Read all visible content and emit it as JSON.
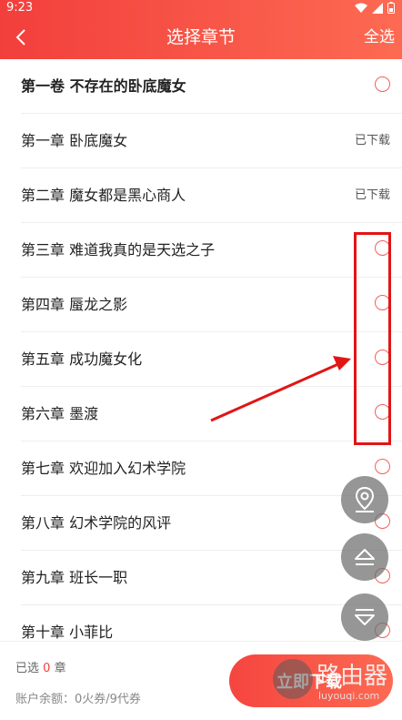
{
  "status_bar": {
    "time": "9:23"
  },
  "app_bar": {
    "title": "选择章节",
    "select_all": "全选"
  },
  "chapters": [
    {
      "title": "第一卷 不存在的卧底魔女",
      "state": "",
      "is_volume": true
    },
    {
      "title": "第一章 卧底魔女",
      "state": "已下载"
    },
    {
      "title": "第二章 魔女都是黑心商人",
      "state": "已下载"
    },
    {
      "title": "第三章 难道我真的是天选之子",
      "state": ""
    },
    {
      "title": "第四章 蜃龙之影",
      "state": ""
    },
    {
      "title": "第五章 成功魔女化",
      "state": ""
    },
    {
      "title": "第六章 墨渡",
      "state": ""
    },
    {
      "title": "第七章 欢迎加入幻术学院",
      "state": ""
    },
    {
      "title": "第八章 幻术学院的风评",
      "state": ""
    },
    {
      "title": "第九章 班长一职",
      "state": ""
    },
    {
      "title": "第十章 小菲比",
      "state": ""
    }
  ],
  "bottom": {
    "selected_prefix": "已选",
    "selected_count": "0",
    "selected_suffix": "章",
    "balance": "账户余额：0火券/9代券",
    "download_label": "立即下载"
  },
  "watermark": {
    "cn": "路由器",
    "en": "luyouqi.com"
  },
  "colors": {
    "accent": "#f23f3c",
    "accent_end": "#fd6a52",
    "annotation": "#e11515"
  },
  "icons": [
    "back-arrow-icon",
    "wifi-icon",
    "signal-icon",
    "battery-icon",
    "location-pin-icon",
    "eject-up-icon",
    "eject-down-icon"
  ]
}
